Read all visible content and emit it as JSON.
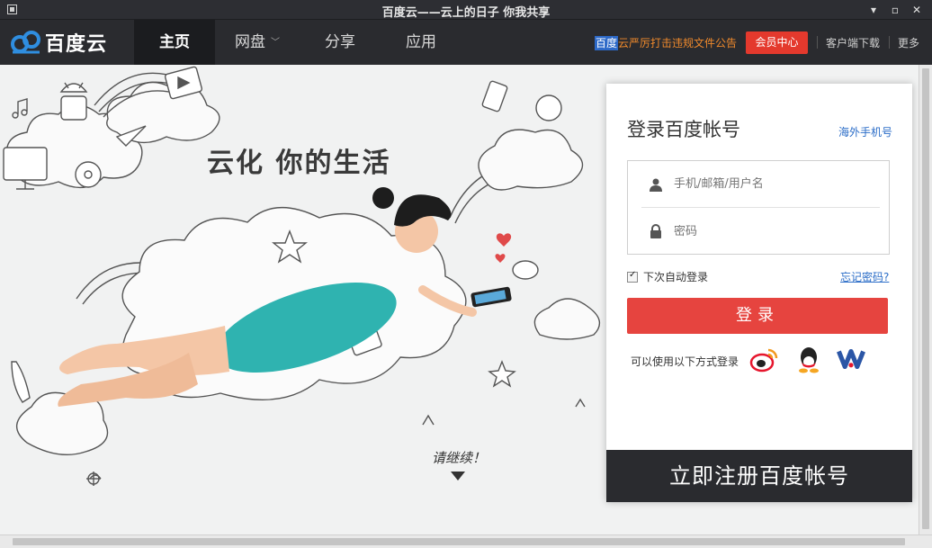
{
  "window": {
    "title": "百度云——云上的日子 你我共享",
    "controls": [
      "▾",
      "▫",
      "✕"
    ]
  },
  "navbar": {
    "logo_text": "百度云",
    "tabs": [
      {
        "label": "主页",
        "active": true
      },
      {
        "label": "网盘",
        "has_dropdown": true
      },
      {
        "label": "分享"
      },
      {
        "label": "应用"
      }
    ],
    "notice_brand": "百度",
    "notice_text": "云严厉打击违规文件公告",
    "vip_button": "会员中心",
    "client_download": "客户端下载",
    "more": "更多"
  },
  "banner": {
    "slogan": "云化 你的生活",
    "continue_hint": "请继续！"
  },
  "login": {
    "title": "登录百度帐号",
    "overseas_link": "海外手机号",
    "username_placeholder": "手机/邮箱/用户名",
    "password_placeholder": "密码",
    "remember_label": "下次自动登录",
    "remember_checked": true,
    "forgot_link": "忘记密码?",
    "submit_label": "登录",
    "alt_login_label": "可以使用以下方式登录",
    "social_icons": [
      "weibo-icon",
      "qq-icon",
      "tianyi-icon"
    ],
    "register_label": "立即注册百度帐号"
  },
  "colors": {
    "accent_red": "#e6443f",
    "link_blue": "#2a6cc7",
    "nav_bg": "#2a2b2f",
    "notice_orange": "#f08a2c"
  }
}
